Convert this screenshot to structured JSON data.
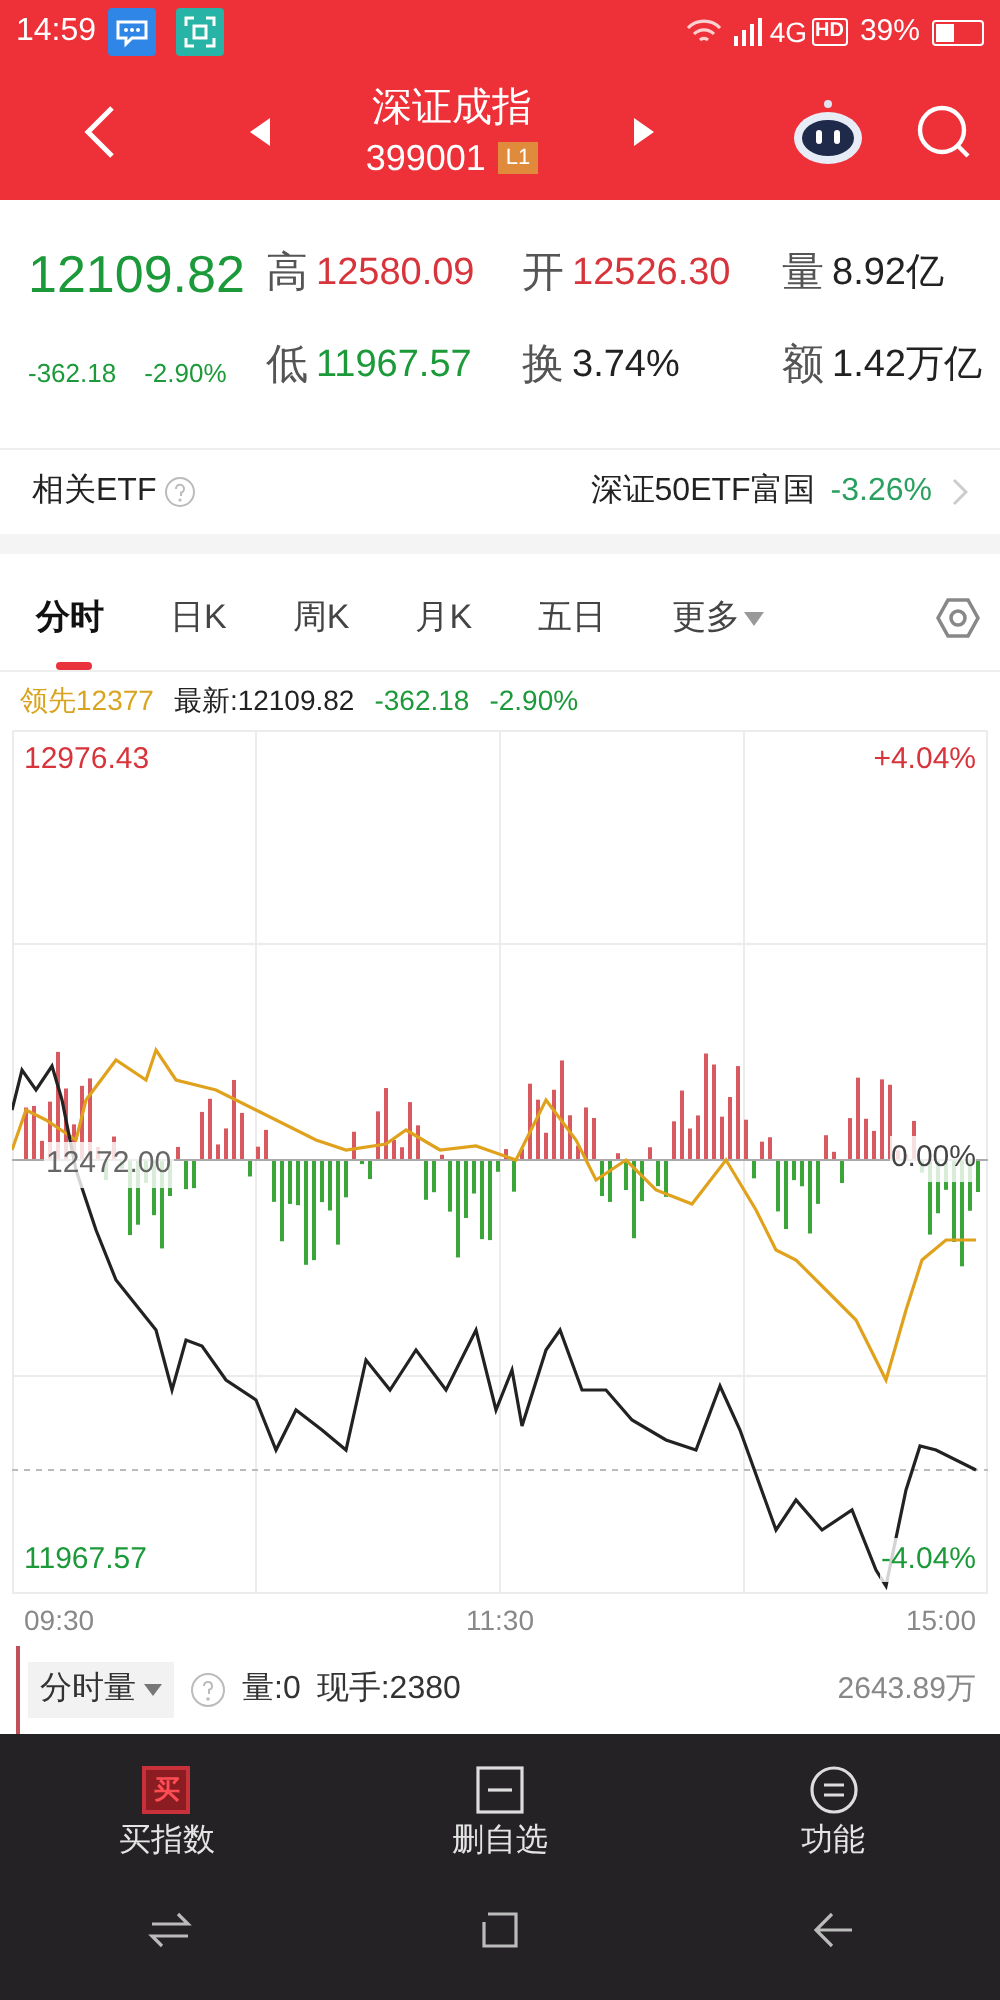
{
  "status_bar": {
    "time": "14:59",
    "network": "4G",
    "hd": "HD",
    "battery": "39%"
  },
  "header": {
    "title": "深证成指",
    "code": "399001",
    "badge": "L1"
  },
  "quote": {
    "price": "12109.82",
    "change": "-362.18",
    "change_pct": "-2.90%",
    "color": "#1c9a3a",
    "stats": [
      {
        "label": "高",
        "value": "12580.09",
        "color": "#d8343c"
      },
      {
        "label": "开",
        "value": "12526.30",
        "color": "#d8343c"
      },
      {
        "label": "量",
        "value": "8.92亿",
        "color": "#222222"
      },
      {
        "label": "低",
        "value": "11967.57",
        "color": "#1c9a3a"
      },
      {
        "label": "换",
        "value": "3.74%",
        "color": "#222222"
      },
      {
        "label": "额",
        "value": "1.42万亿",
        "color": "#222222"
      }
    ]
  },
  "etf": {
    "label": "相关ETF",
    "fund_name": "深证50ETF富国",
    "fund_change": "-3.26%",
    "color": "#2aa060"
  },
  "tabs": [
    {
      "label": "分时",
      "selected": true,
      "has_menu": false
    },
    {
      "label": "日K",
      "selected": false,
      "has_menu": false
    },
    {
      "label": "周K",
      "selected": false,
      "has_menu": false
    },
    {
      "label": "月K",
      "selected": false,
      "has_menu": false
    },
    {
      "label": "五日",
      "selected": false,
      "has_menu": false
    },
    {
      "label": "更多",
      "selected": false,
      "has_menu": true
    }
  ],
  "chart_info": {
    "leader": "领先12377",
    "latest": "最新:12109.82",
    "change": "-362.18",
    "change_pct": "-2.90%"
  },
  "chart": {
    "price_max": "12976.43",
    "price_mid": "12472.00",
    "price_min": "11967.57",
    "pct_max": "+4.04%",
    "pct_mid": "0.00%",
    "pct_min": "-4.04%",
    "times": [
      "09:30",
      "11:30",
      "15:00"
    ]
  },
  "volume": {
    "selector": "分时量",
    "volume": "量:0",
    "hand": "现手:2380",
    "total": "2643.89万"
  },
  "bottom_nav": [
    {
      "kind": "buy",
      "glyph": "买",
      "label": "买指数"
    },
    {
      "kind": "remove",
      "label": "删自选"
    },
    {
      "kind": "menu",
      "label": "功能"
    }
  ]
}
